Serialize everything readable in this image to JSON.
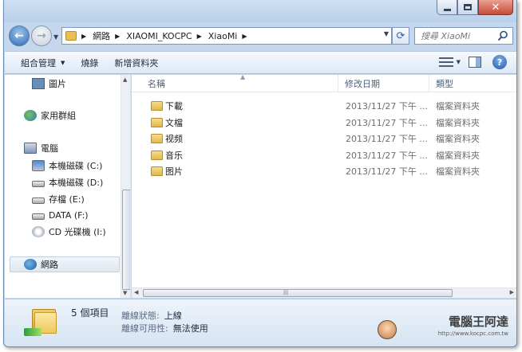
{
  "nav": {
    "breadcrumbs": [
      "網路",
      "XIAOMI_KOCPC",
      "XiaoMi"
    ],
    "search_placeholder": "搜尋 XiaoMi"
  },
  "toolbar": {
    "organize_label": "組合管理",
    "burn_label": "燒錄",
    "new_folder_label": "新增資料夾"
  },
  "sidebar": {
    "items": [
      {
        "label": "圖片",
        "icon": "pictures-icon"
      },
      {
        "label": "家用群組",
        "icon": "homegroup-icon"
      },
      {
        "label": "電腦",
        "icon": "computer-icon"
      },
      {
        "label": "本機磁碟 (C:)",
        "icon": "system-drive-icon"
      },
      {
        "label": "本機磁碟 (D:)",
        "icon": "drive-icon"
      },
      {
        "label": "存檔 (E:)",
        "icon": "drive-icon"
      },
      {
        "label": "DATA (F:)",
        "icon": "drive-icon"
      },
      {
        "label": "CD 光碟機 (I:)",
        "icon": "dvd-drive-icon"
      },
      {
        "label": "網路",
        "icon": "network-icon"
      }
    ]
  },
  "columns": {
    "name": "名稱",
    "modified": "修改日期",
    "type": "類型"
  },
  "files": [
    {
      "name": "下載",
      "date": "2013/11/27 下午 ...",
      "type": "檔案資料夾"
    },
    {
      "name": "文檔",
      "date": "2013/11/27 下午 ...",
      "type": "檔案資料夾"
    },
    {
      "name": "视频",
      "date": "2013/11/27 下午 ...",
      "type": "檔案資料夾"
    },
    {
      "name": "音乐",
      "date": "2013/11/27 下午 ...",
      "type": "檔案資料夾"
    },
    {
      "name": "图片",
      "date": "2013/11/27 下午 ...",
      "type": "檔案資料夾"
    }
  ],
  "details": {
    "count": "5 個項目",
    "status_key": "離線狀態:",
    "status_value": "上線",
    "availability_key": "離線可用性:",
    "availability_value": "無法使用"
  },
  "watermark": {
    "name": "電腦王阿達",
    "url": "http://www.kocpc.com.tw"
  }
}
